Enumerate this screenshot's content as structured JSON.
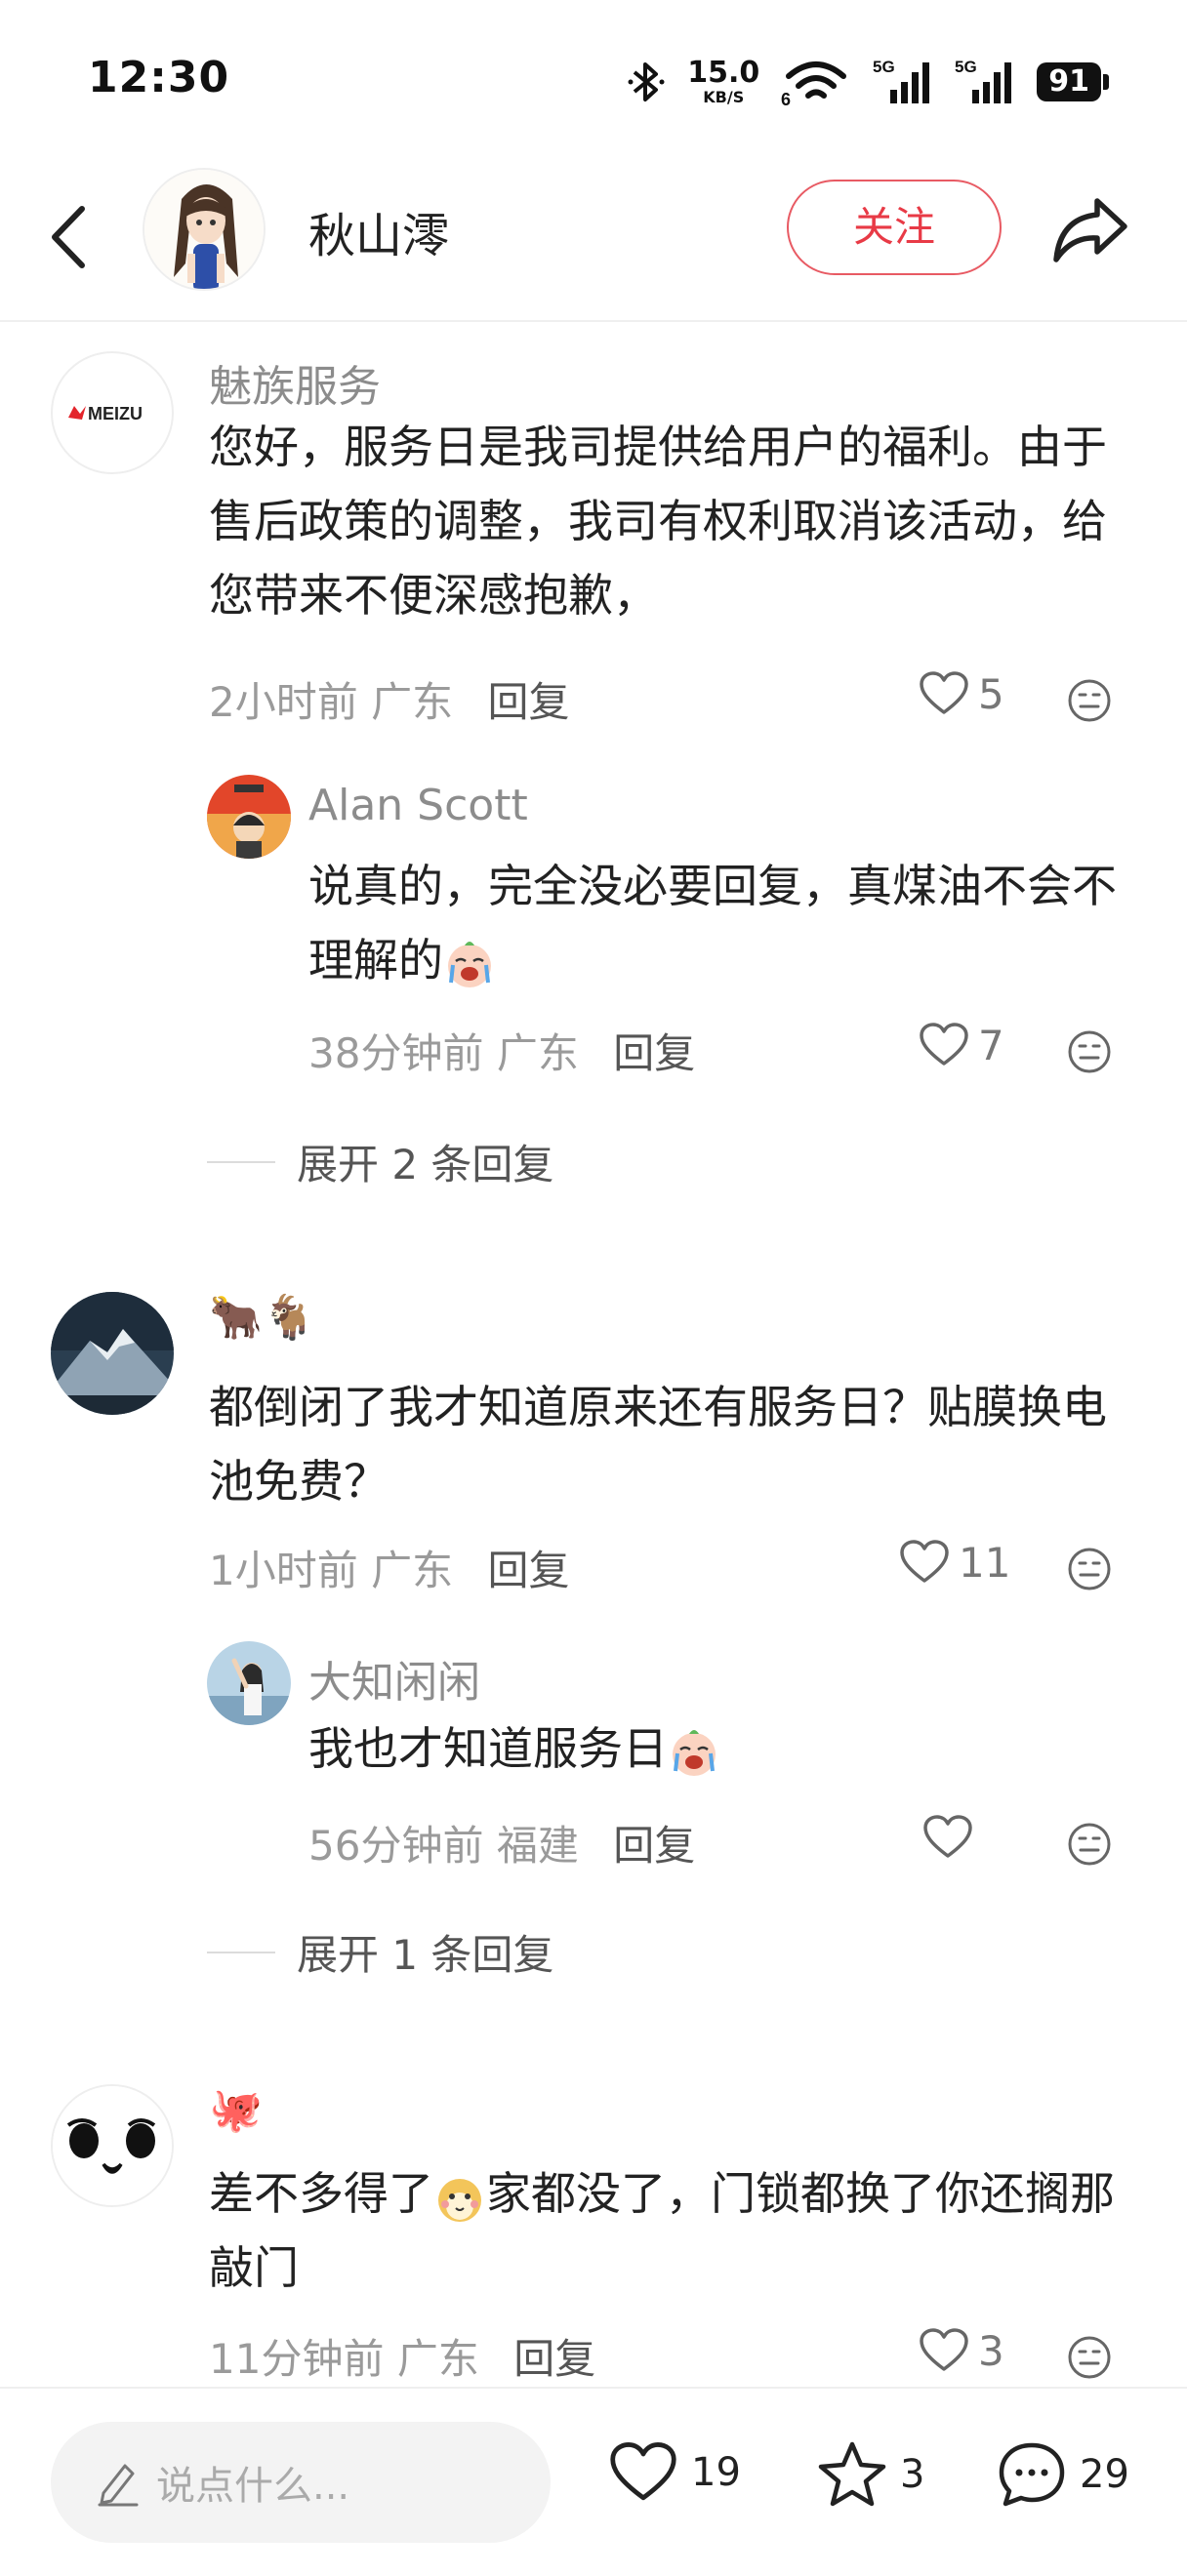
{
  "status_bar": {
    "time": "12:30",
    "net_speed": "15.0",
    "net_unit": "KB/S",
    "wifi_label": "6",
    "signal1_label": "5G",
    "signal2_label": "5G",
    "battery": "91"
  },
  "header": {
    "author_name": "秋山澪",
    "follow_label": "关注"
  },
  "comments": [
    {
      "user": "魅族服务",
      "avatar_label": "MEIZU",
      "text": "您好，服务日是我司提供给用户的福利。由于售后政策的调整，我司有权利取消该活动，给您带来不便深感抱歉，",
      "time": "2小时前",
      "location": "广东",
      "reply_label": "回复",
      "likes": "5",
      "replies": [
        {
          "user": "Alan Scott",
          "text": "说真的，完全没必要回复，真煤油不会不理解的",
          "time": "38分钟前",
          "location": "广东",
          "reply_label": "回复",
          "likes": "7"
        }
      ],
      "expand_label": "展开 2 条回复"
    },
    {
      "user": "🐂🐐",
      "text": "都倒闭了我才知道原来还有服务日？贴膜换电池免费？",
      "time": "1小时前",
      "location": "广东",
      "reply_label": "回复",
      "likes": "11",
      "replies": [
        {
          "user": "大知闲闲",
          "text": "我也才知道服务日",
          "time": "56分钟前",
          "location": "福建",
          "reply_label": "回复",
          "likes": ""
        }
      ],
      "expand_label": "展开 1 条回复"
    },
    {
      "user": "🐙",
      "text_before": "差不多得了",
      "text_after": "家都没了，门锁都换了你还搁那敲门",
      "time": "11分钟前",
      "location": "广东",
      "reply_label": "回复",
      "likes": "3"
    }
  ],
  "bottom_bar": {
    "input_placeholder": "说点什么...",
    "like_count": "19",
    "star_count": "3",
    "comment_count": "29"
  },
  "colors": {
    "accent": "#e83a46",
    "meta_gray": "#9a9a9a",
    "username_gray": "#8c8c8c"
  }
}
